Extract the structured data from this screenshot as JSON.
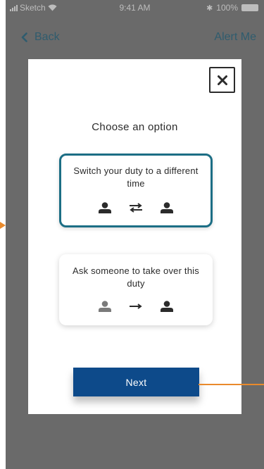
{
  "status_bar": {
    "carrier": "Sketch",
    "time": "9:41 AM",
    "battery": "100%"
  },
  "nav": {
    "back_label": "Back",
    "alert_label": "Alert Me"
  },
  "modal": {
    "title": "Choose an option",
    "options": [
      {
        "label": "Switch your duty to a different time",
        "selected": true
      },
      {
        "label": "Ask someone to take over this duty",
        "selected": false
      }
    ],
    "next_label": "Next"
  },
  "colors": {
    "accent": "#1c6e85",
    "primary_button": "#0d4a8a",
    "annotation": "#e98a2c",
    "overlay": "#6a6a6a"
  },
  "icons": [
    "close-icon",
    "user-icon",
    "swap-arrows-icon",
    "right-arrow-icon",
    "chevron-left-icon",
    "wifi-icon",
    "battery-icon",
    "signal-icon"
  ]
}
